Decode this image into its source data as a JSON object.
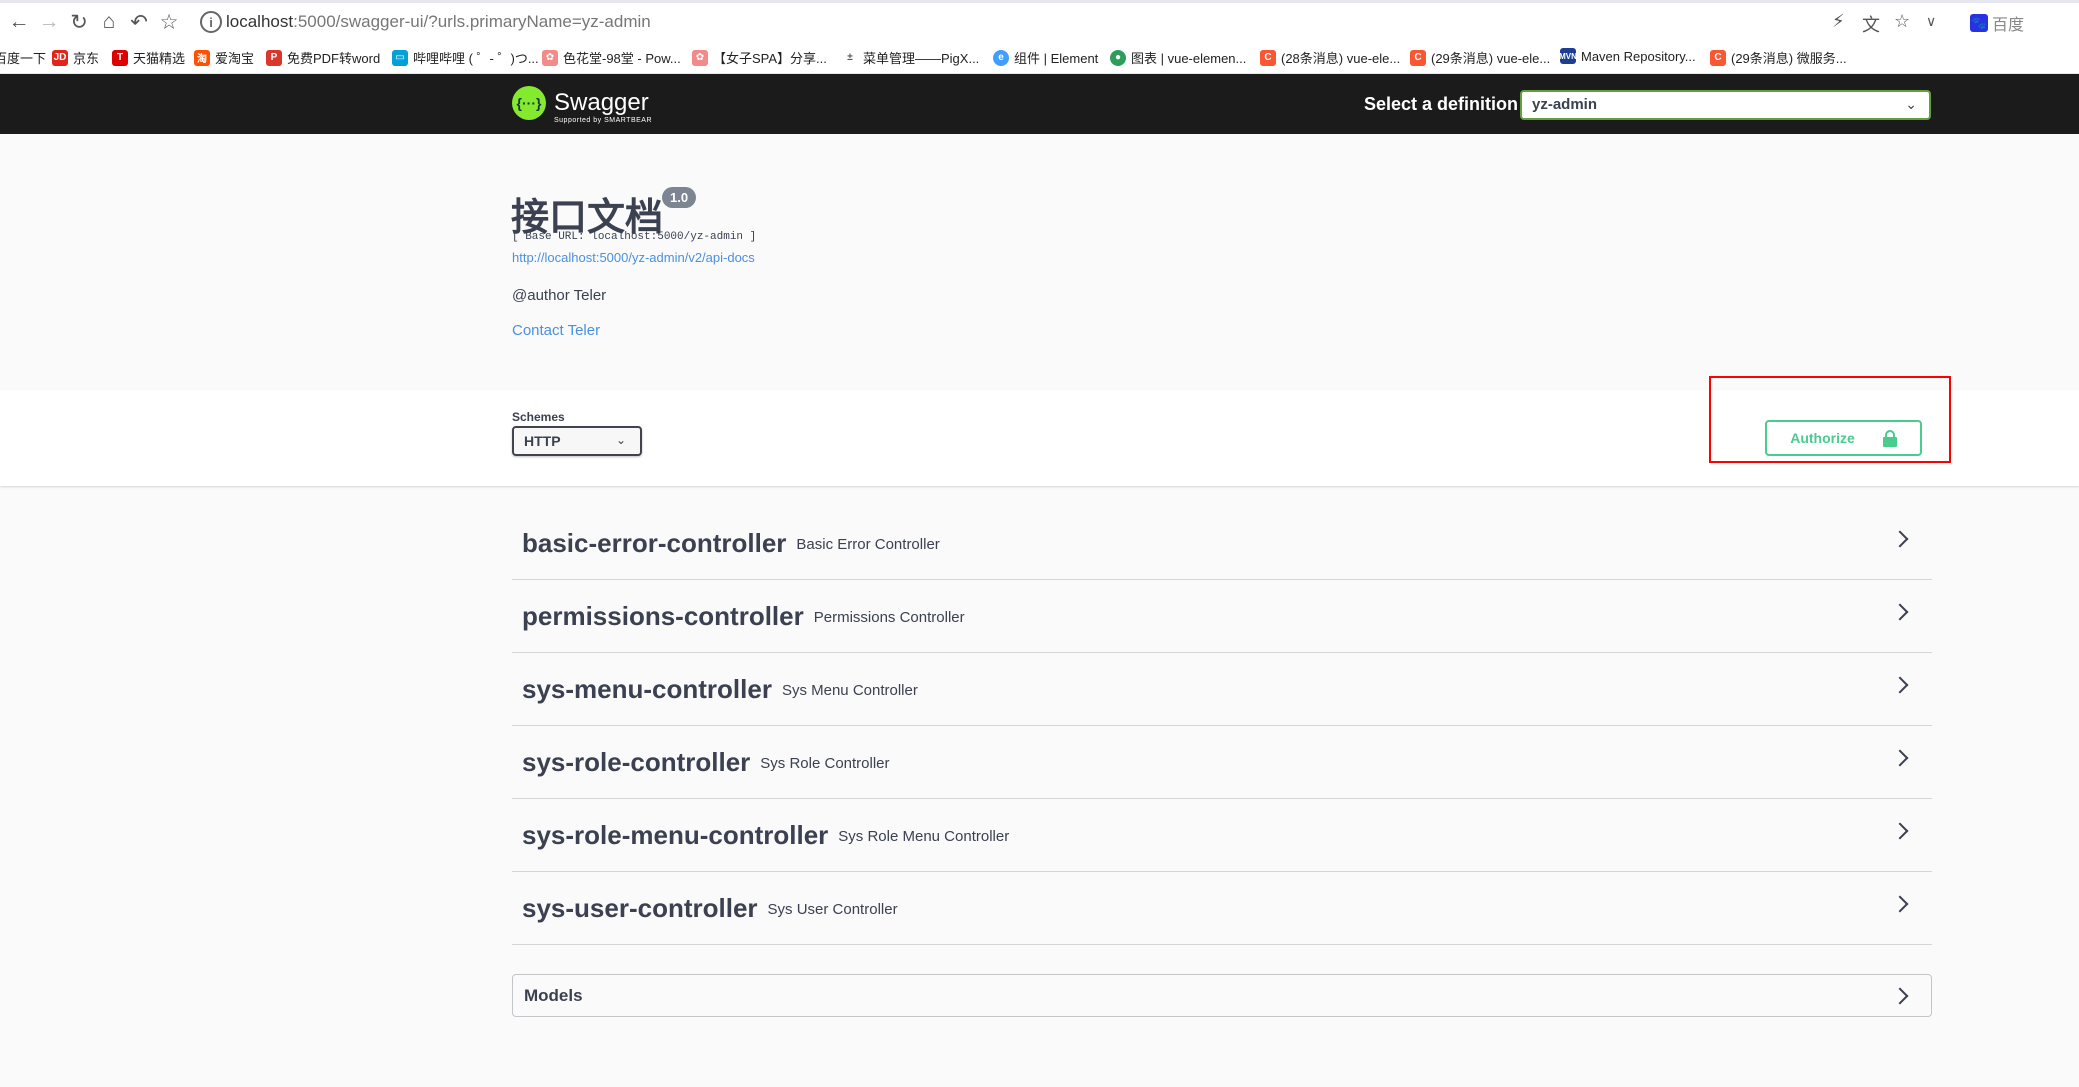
{
  "browser": {
    "url_host": "localhost",
    "url_rest": ":5000/swagger-ui/?urls.primaryName=yz-admin",
    "right_label": "百度",
    "bookmarks": [
      {
        "label": "百度一下",
        "color": "#2932e1",
        "icon": "baidu-icon"
      },
      {
        "label": "京东",
        "color": "#e1251b",
        "icon": "jd-icon"
      },
      {
        "label": "天猫精选",
        "color": "#d00",
        "icon": "tmall-icon"
      },
      {
        "label": "爱淘宝",
        "color": "#ff5000",
        "icon": "taobao-icon"
      },
      {
        "label": "免费PDF转word",
        "color": "#d9372b",
        "icon": "pdf-icon"
      },
      {
        "label": "哔哩哔哩 ( ゜- ゜)つ...",
        "color": "#00a1d6",
        "icon": "bilibili-icon"
      },
      {
        "label": "色花堂-98堂 - Pow...",
        "color": "#f38a8a",
        "icon": "flower-icon"
      },
      {
        "label": "【女子SPA】分享...",
        "color": "#f38a8a",
        "icon": "flower-icon"
      },
      {
        "label": "菜单管理——PigX...",
        "color": "#555",
        "icon": "pigx-icon"
      },
      {
        "label": "组件 | Element",
        "color": "#409eff",
        "icon": "element-icon"
      },
      {
        "label": "图表 | vue-elemen...",
        "color": "#2c9e5a",
        "icon": "chart-icon"
      },
      {
        "label": "(28条消息) vue-ele...",
        "color": "#fc5531",
        "icon": "csdn-icon"
      },
      {
        "label": "(29条消息) vue-ele...",
        "color": "#fc5531",
        "icon": "csdn-icon"
      },
      {
        "label": "Maven Repository...",
        "color": "#1e3f91",
        "icon": "maven-icon"
      },
      {
        "label": "(29条消息) 微服务...",
        "color": "#fc5531",
        "icon": "csdn-icon"
      }
    ]
  },
  "topbar": {
    "logo_symbol": "{···}",
    "logo_text": "Swagger",
    "logo_sub": "Supported by SMARTBEAR",
    "definition_label": "Select a definition",
    "definition_value": "yz-admin"
  },
  "info": {
    "title": "接口文档",
    "version": "1.0",
    "base_url": "[ Base URL: localhost:5000/yz-admin ]",
    "api_docs": "http://localhost:5000/yz-admin/v2/api-docs",
    "author": "@author Teler",
    "contact": "Contact Teler"
  },
  "schemes": {
    "label": "Schemes",
    "value": "HTTP",
    "authorize": "Authorize"
  },
  "tags": [
    {
      "name": "basic-error-controller",
      "desc": "Basic Error Controller"
    },
    {
      "name": "permissions-controller",
      "desc": "Permissions Controller"
    },
    {
      "name": "sys-menu-controller",
      "desc": "Sys Menu Controller"
    },
    {
      "name": "sys-role-controller",
      "desc": "Sys Role Controller"
    },
    {
      "name": "sys-role-menu-controller",
      "desc": "Sys Role Menu Controller"
    },
    {
      "name": "sys-user-controller",
      "desc": "Sys User Controller"
    }
  ],
  "models": {
    "label": "Models"
  }
}
